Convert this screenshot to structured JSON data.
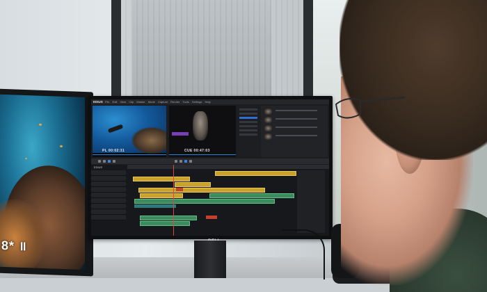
{
  "scene": {
    "description_tags": [
      "office",
      "window",
      "monitor",
      "video-editor",
      "desk-phone",
      "person-with-glasses"
    ],
    "colors": {
      "editor_bg": "#1c1d20",
      "timeline_yellow": "#c8a22c",
      "timeline_green": "#3d8a5e",
      "selection_blue": "#2f6fd0",
      "underwater_blue": "#1b6f93"
    }
  },
  "left_monitor": {
    "overlay_text": "8* ॥"
  },
  "main_monitor": {
    "brand": "DELL",
    "editor": {
      "app_title": "EDIUS",
      "menu_items": "File Edit View Clip Marker Mode Capture Render Tools Settings Help",
      "source_player": {
        "timecode": "PL 00:02:31"
      },
      "record_player": {
        "timecode": "CUE 00:47:03"
      },
      "timeline_label": "EDIUS"
    }
  },
  "icons": [
    "play-icon",
    "stop-icon",
    "rewind-icon",
    "forward-icon",
    "phone-keypad-icon"
  ]
}
